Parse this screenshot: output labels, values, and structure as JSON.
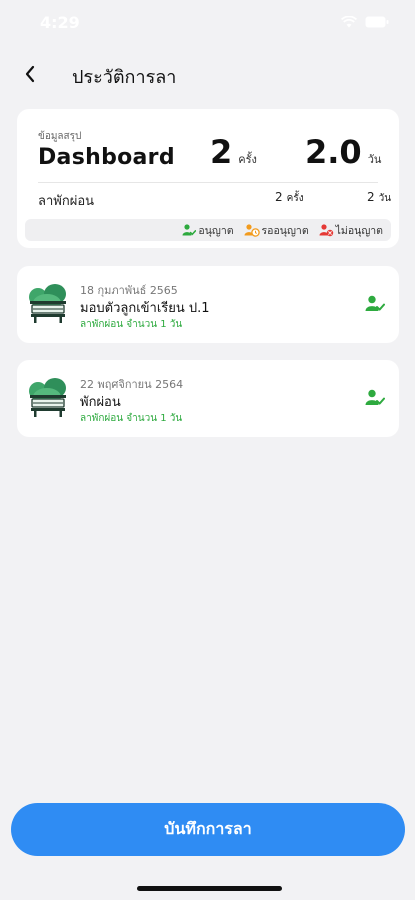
{
  "status_bar": {
    "time": "4:29"
  },
  "header": {
    "title": "ประวัติการลา"
  },
  "summary": {
    "caption": "ข้อมูลสรุป",
    "heading": "Dashboard",
    "total_count": "2",
    "count_unit": "ครั้ง",
    "total_days": "2.0",
    "days_unit": "วัน",
    "rows": [
      {
        "label": "ลาพักผ่อน",
        "count": "2",
        "count_unit": "ครั้ง",
        "days": "2",
        "days_unit": "วัน"
      }
    ],
    "legend": [
      {
        "label": "อนุญาต",
        "color": "#2eaa3f",
        "icon": "user-check-icon"
      },
      {
        "label": "รออนุญาต",
        "color": "#f29b1d",
        "icon": "user-clock-icon"
      },
      {
        "label": "ไม่อนุญาต",
        "color": "#e53935",
        "icon": "user-x-icon"
      }
    ]
  },
  "leave_records": [
    {
      "date": "18 กุมภาพันธ์ 2565",
      "title": "มอบตัวลูกเข้าเรียน ป.1",
      "subtitle": "ลาพักผ่อน จำนวน 1 วัน",
      "status_icon": "user-check-icon"
    },
    {
      "date": "22 พฤศจิกายน 2564",
      "title": "พักผ่อน",
      "subtitle": "ลาพักผ่อน จำนวน 1 วัน",
      "status_icon": "user-check-icon"
    }
  ],
  "actions": {
    "save_label": "บันทึกการลา"
  },
  "colors": {
    "accent": "#2f8cf3",
    "approved": "#2eaa3f",
    "pending": "#f29b1d",
    "rejected": "#e53935"
  }
}
